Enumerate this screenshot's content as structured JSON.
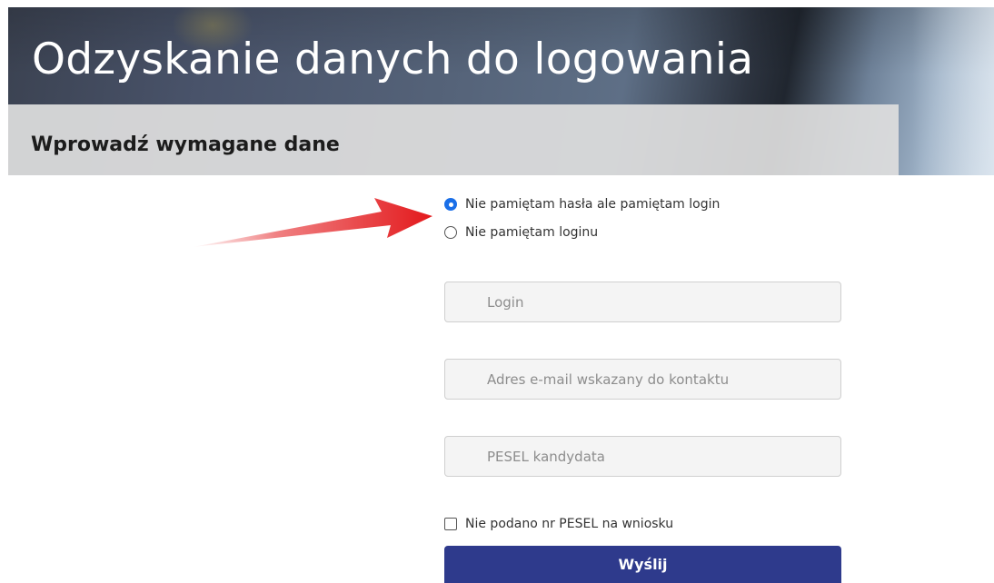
{
  "header": {
    "title": "Odzyskanie danych do logowania",
    "subtitle": "Wprowadź wymagane dane"
  },
  "recovery_options": [
    {
      "label": "Nie pamiętam hasła ale pamiętam login",
      "checked": true
    },
    {
      "label": "Nie pamiętam loginu",
      "checked": false
    }
  ],
  "form": {
    "login_placeholder": "Login",
    "email_placeholder": "Adres e-mail wskazany do kontaktu",
    "pesel_placeholder": "PESEL kandydata",
    "no_pesel_label": "Nie podano nr PESEL na wniosku",
    "no_pesel_checked": false,
    "submit_label": "Wyślij"
  },
  "colors": {
    "accent_radio": "#1a6fe8",
    "submit_button": "#2e3a8c",
    "annotation_arrow": "#e3191c"
  },
  "icons": {
    "annotation": "red-arrow-icon"
  }
}
